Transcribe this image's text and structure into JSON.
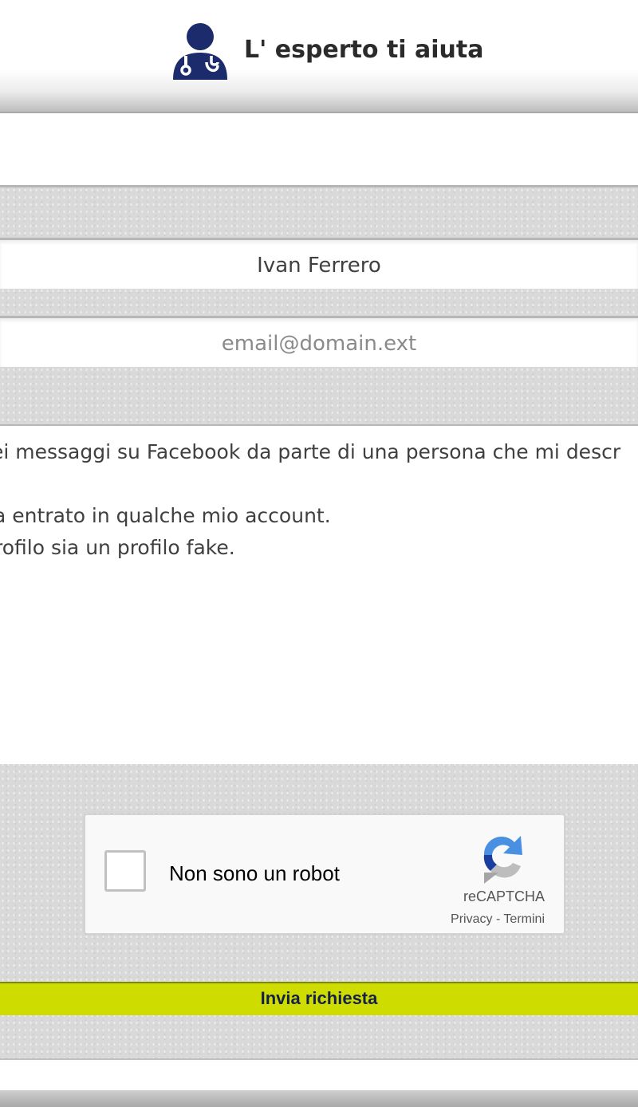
{
  "header": {
    "title": "L' esperto ti aiuta",
    "logo_icon": "doctor-stethoscope-icon",
    "logo_color": "#1b2b6b"
  },
  "form": {
    "name_value": "Ivan Ferrero",
    "email_placeholder": "email@domain.ext",
    "message_lines": [
      "ei messaggi su Facebook da parte di una persona che mi descr",
      "a entrato in qualche mio account.",
      "rofilo sia un profilo fake."
    ]
  },
  "captcha": {
    "label": "Non sono un robot",
    "brand": "reCAPTCHA",
    "links": "Privacy - Termini",
    "icon": "recaptcha-icon"
  },
  "submit": {
    "label": "Invia richiesta",
    "color": "#cfdc00"
  }
}
